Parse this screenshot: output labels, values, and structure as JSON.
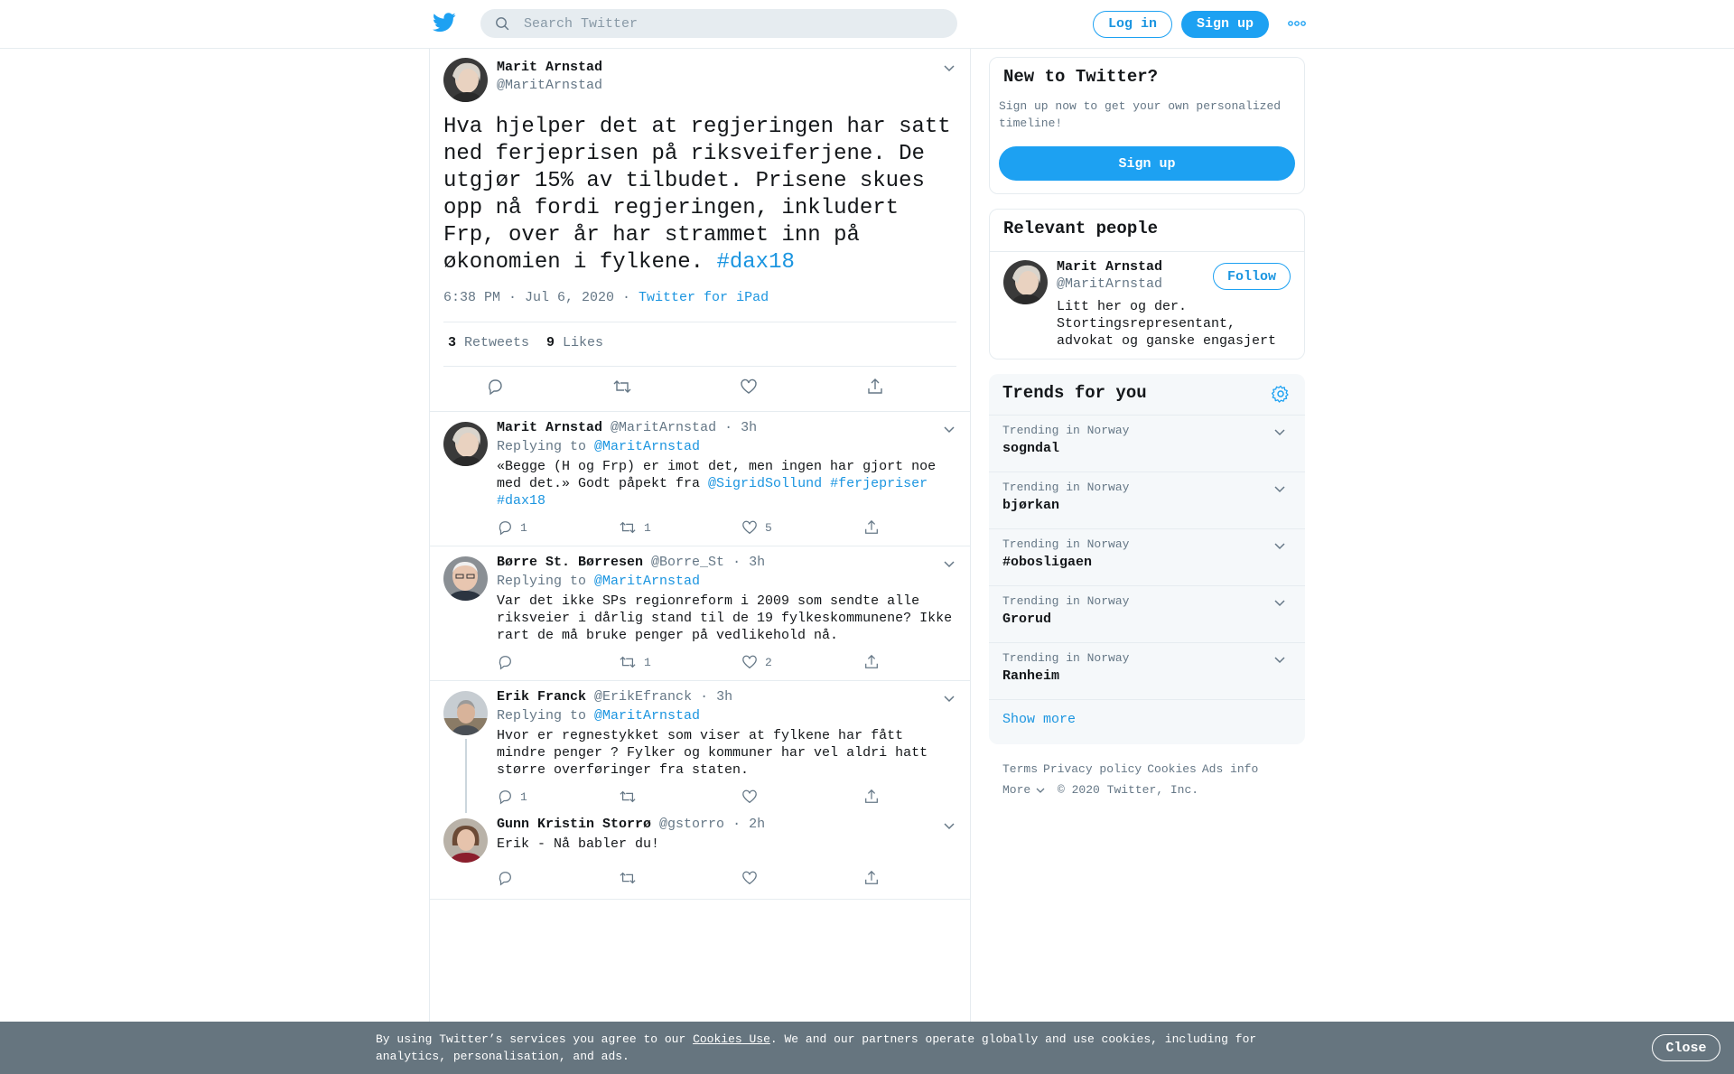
{
  "header": {
    "search_placeholder": "Search Twitter",
    "login_label": "Log in",
    "signup_label": "Sign up"
  },
  "focus_tweet": {
    "name": "Marit Arnstad",
    "handle": "@MaritArnstad",
    "text": "Hva hjelper det at regjeringen har satt ned ferjeprisen på riksveiferjene. De utgjør 15% av tilbudet. Prisene skues opp nå fordi regjeringen, inkludert Frp, over år har strammet inn på økonomien i fylkene. ",
    "hashtag": "#dax18",
    "timestamp": "6:38 PM · Jul 6, 2020",
    "separator": " · ",
    "source": "Twitter for iPad",
    "retweets_count": "3",
    "retweets_label": "Retweets",
    "likes_count": "9",
    "likes_label": "Likes"
  },
  "replies": [
    {
      "name": "Marit Arnstad",
      "handle": "@MaritArnstad",
      "time": "· 3h",
      "replying_prefix": "Replying to ",
      "replying_to": "@MaritArnstad",
      "text_1": "«Begge (H og Frp) er imot det, men ingen har gjort noe med det.»  Godt påpekt fra ",
      "mention": "@SigridSollund",
      "tag_1": "#ferjepriser",
      "tag_2": "#dax18",
      "replies": "1",
      "retweets": "1",
      "likes": "5"
    },
    {
      "name": "Børre St. Børresen",
      "handle": "@Borre_St",
      "time": "· 3h",
      "replying_prefix": "Replying to ",
      "replying_to": "@MaritArnstad",
      "text": "Var det ikke SPs regionreform i 2009 som sendte alle riksveier i dårlig stand til de 19 fylkeskommunene? Ikke rart de må bruke penger på vedlikehold nå.",
      "replies": "",
      "retweets": "1",
      "likes": "2"
    },
    {
      "name": "Erik Franck",
      "handle": "@ErikEfranck",
      "time": "· 3h",
      "replying_prefix": "Replying to ",
      "replying_to": "@MaritArnstad",
      "text": "Hvor er regnestykket som viser at fylkene har fått mindre penger ?  Fylker og kommuner har vel aldri hatt større overføringer fra staten.",
      "replies": "1",
      "retweets": "",
      "likes": ""
    },
    {
      "name": "Gunn Kristin Storrø",
      "handle": "@gstorro",
      "time": "· 2h",
      "text": "Erik - Nå babler du!",
      "replies": "",
      "retweets": "",
      "likes": ""
    }
  ],
  "sidebar": {
    "signup_title": "New to Twitter?",
    "signup_sub": "Sign up now to get your own personalized timeline!",
    "signup_button": "Sign up",
    "people_title": "Relevant people",
    "person_name": "Marit Arnstad",
    "person_handle": "@MaritArnstad",
    "person_bio": "Litt her og der. Stortingsrepresentant, advokat og ganske engasjert",
    "follow_label": "Follow",
    "trends_title": "Trends for you",
    "trends": [
      {
        "meta": "Trending in Norway",
        "name": "sogndal"
      },
      {
        "meta": "Trending in Norway",
        "name": "bjørkan"
      },
      {
        "meta": "Trending in Norway",
        "name": "#obosligaen"
      },
      {
        "meta": "Trending in Norway",
        "name": "Grorud"
      },
      {
        "meta": "Trending in Norway",
        "name": "Ranheim"
      }
    ],
    "show_more": "Show more",
    "footer": {
      "terms": "Terms",
      "privacy": "Privacy policy",
      "cookies": "Cookies",
      "ads": "Ads info",
      "more": "More",
      "copyright": "© 2020 Twitter, Inc."
    }
  },
  "cookie_bar": {
    "text_before": "By using Twitter’s services you agree to our ",
    "link": "Cookies Use",
    "text_after": ". We and our partners operate globally and use cookies, including for analytics, personalisation, and ads.",
    "close_label": "Close"
  },
  "colors": {
    "accent": "#1da1f2",
    "link": "#1b95e0",
    "muted": "#657786",
    "cookie_bar": "#66757f"
  }
}
